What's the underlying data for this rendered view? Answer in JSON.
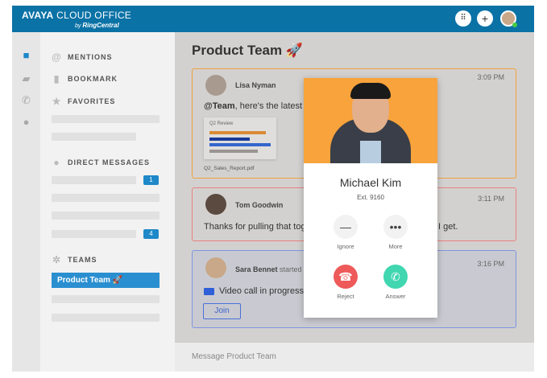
{
  "header": {
    "brand": "AVAYA",
    "brand_rest": "CLOUD OFFICE",
    "byline": "by",
    "partner": "RingCentral",
    "icons": [
      "dialpad-icon",
      "plus-icon",
      "avatar"
    ],
    "accent": "#0b72a6"
  },
  "rail": {
    "icons": [
      "chat-icon",
      "video-icon",
      "phone-icon",
      "contacts-icon"
    ]
  },
  "sidebar": {
    "mentions": "MENTIONS",
    "bookmark": "BOOKMARK",
    "favorites": "FAVORITES",
    "direct_messages": "DIRECT MESSAGES",
    "dm_badges": [
      "1",
      "4"
    ],
    "teams": "TEAMS",
    "selected_team": "Product Team 🚀"
  },
  "main": {
    "title": "Product Team 🚀",
    "messages": [
      {
        "author": "Lisa Nyman",
        "time": "3:09 PM",
        "mention": "@Team",
        "text": ", here's the latest",
        "attachment_title": "Q2 Review",
        "attachment_name": "Q2_Sales_Report.pdf",
        "border": "#f0a040"
      },
      {
        "author": "Tom Goodwin",
        "time": "3:11 PM",
        "text": "Thanks for pulling that tog",
        "text_tail": "I get.",
        "border": "#e88080"
      },
      {
        "author": "Sara Bennet",
        "action": "started a",
        "time": "3:16 PM",
        "text": "Video call in progress",
        "join": "Join",
        "border": "#7d95e0"
      }
    ],
    "input_placeholder": "Message Product Team"
  },
  "call": {
    "name": "Michael Kim",
    "ext": "Ext. 9160",
    "ignore": "Ignore",
    "more": "More",
    "reject": "Reject",
    "answer": "Answer",
    "reject_color": "#ee5a5a",
    "answer_color": "#3fd6b0",
    "photo_bg": "#f8a33b"
  }
}
